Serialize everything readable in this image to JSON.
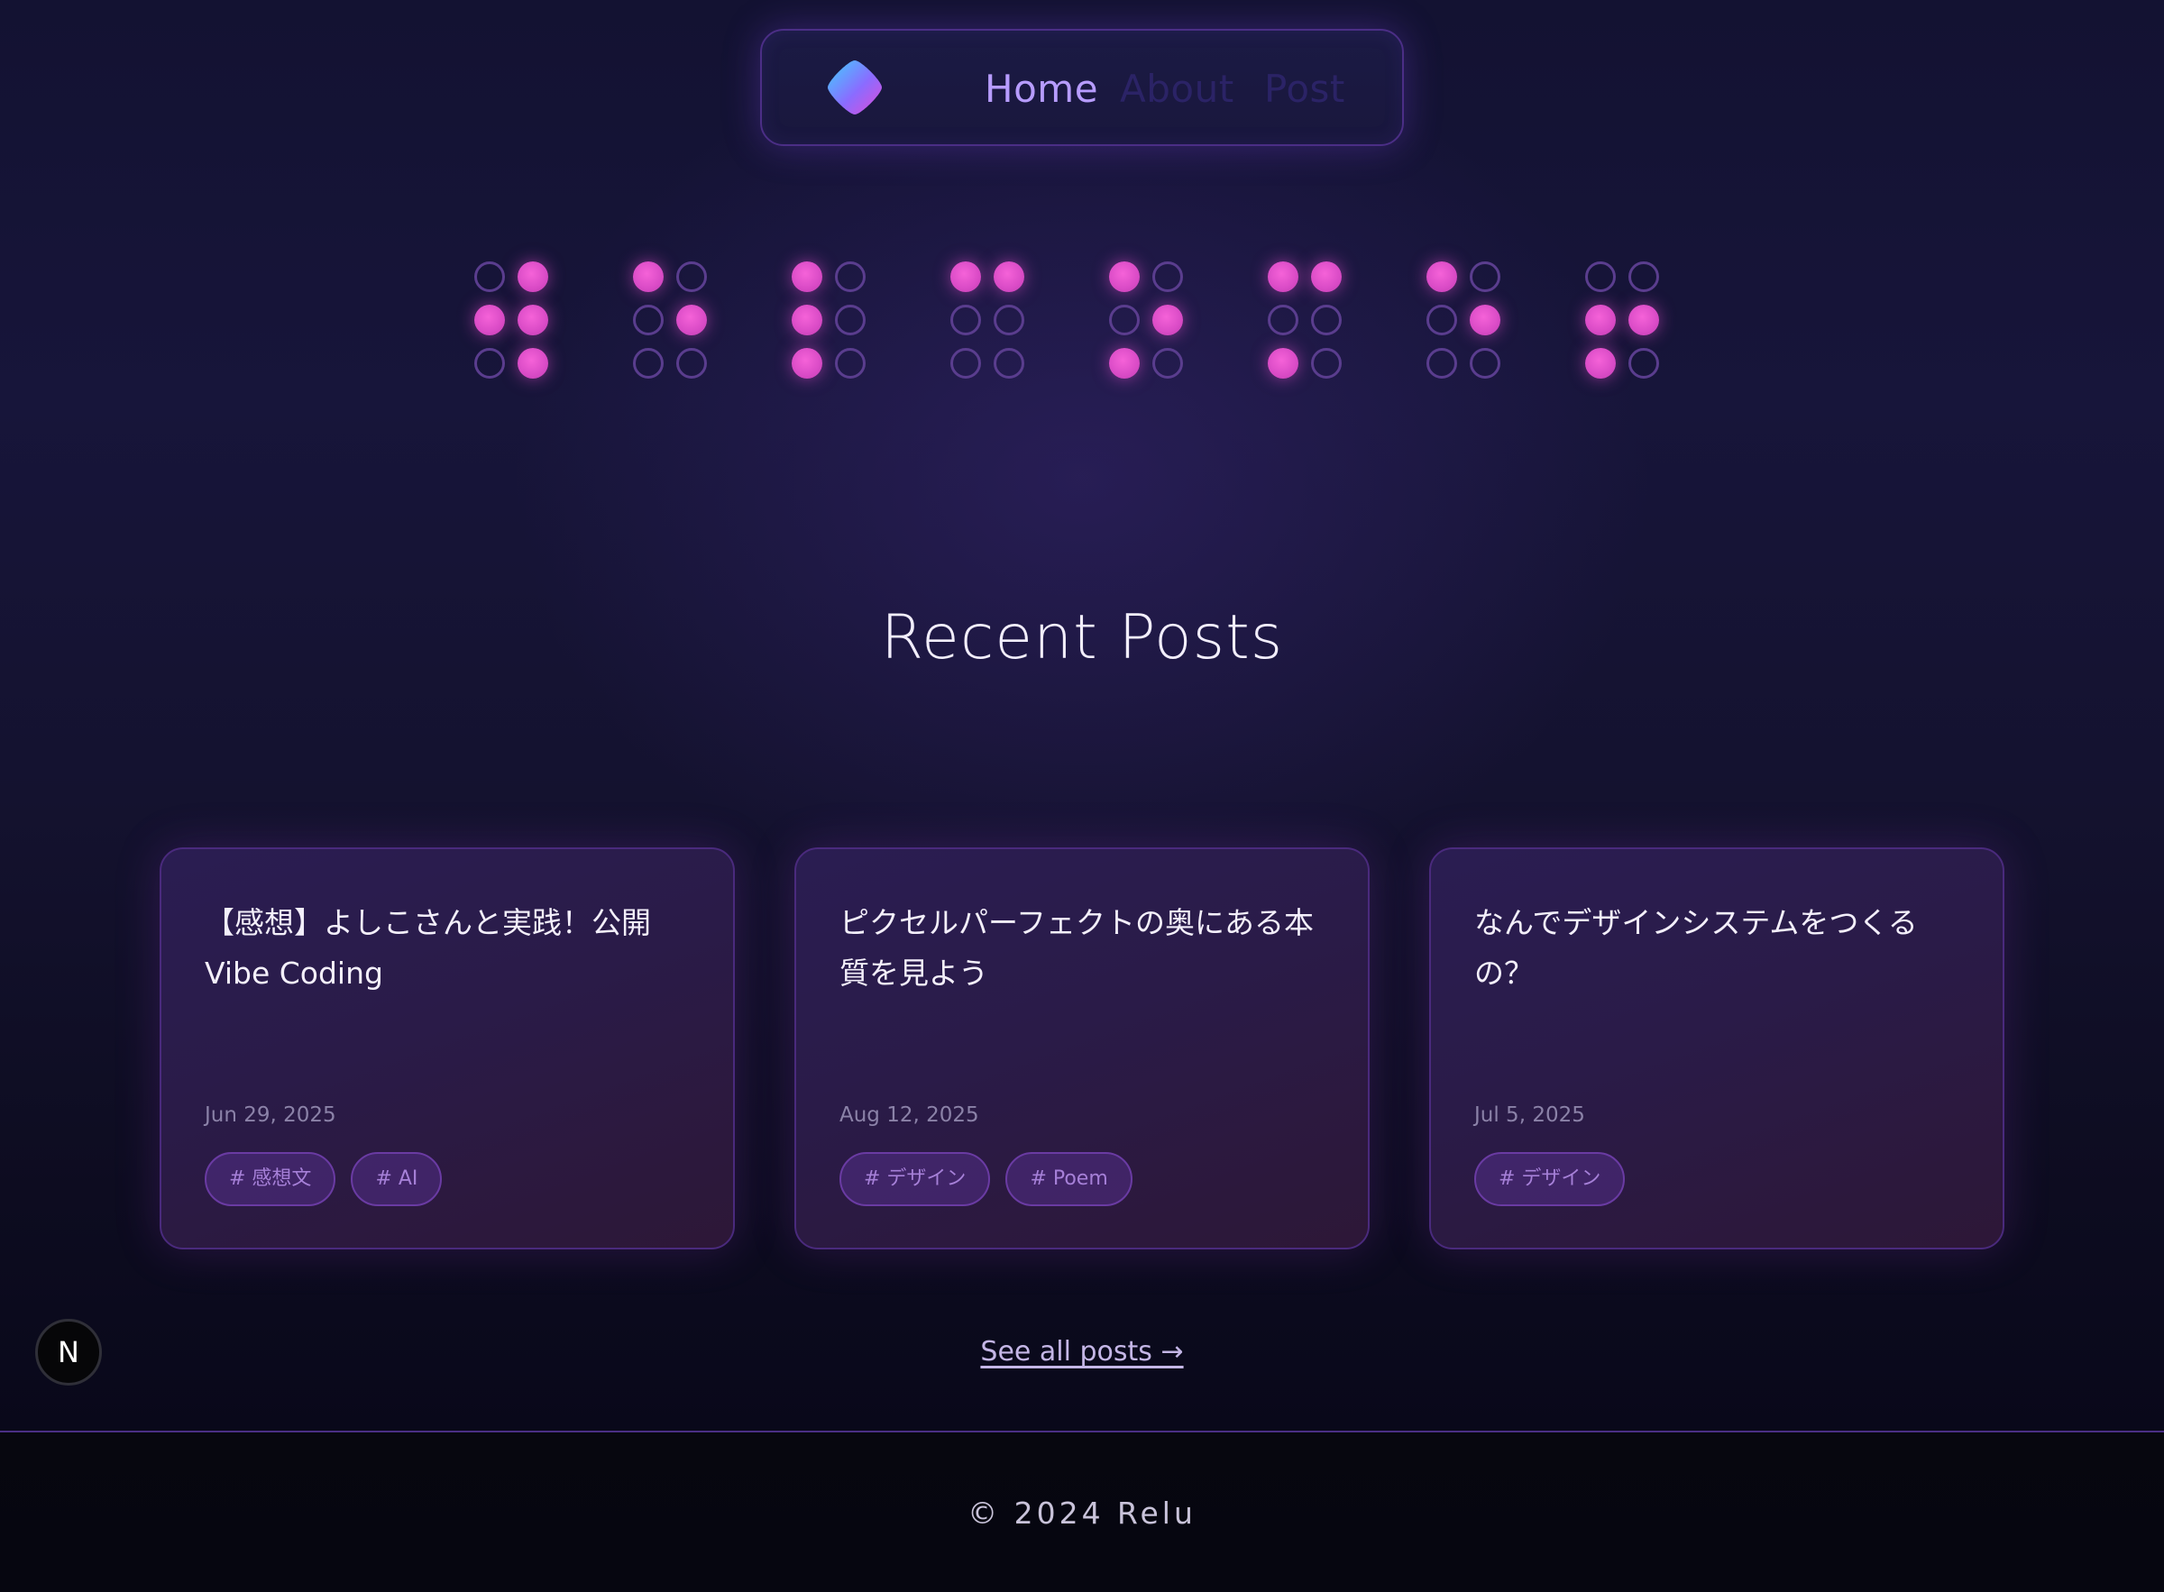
{
  "nav": {
    "logo": "logo-gem",
    "links": [
      {
        "label": "Home",
        "active": true
      },
      {
        "label": "About",
        "active": false
      },
      {
        "label": "Post",
        "active": false
      }
    ]
  },
  "dot_pattern": [
    [
      [
        0,
        1
      ],
      [
        1,
        1
      ],
      [
        0,
        1
      ]
    ],
    [
      [
        1,
        0
      ],
      [
        0,
        1
      ],
      [
        0,
        0
      ]
    ],
    [
      [
        1,
        0
      ],
      [
        1,
        0
      ],
      [
        1,
        0
      ]
    ],
    [
      [
        1,
        1
      ],
      [
        0,
        0
      ],
      [
        0,
        0
      ]
    ],
    [
      [
        1,
        0
      ],
      [
        0,
        1
      ],
      [
        1,
        0
      ]
    ],
    [
      [
        1,
        1
      ],
      [
        0,
        0
      ],
      [
        1,
        0
      ]
    ],
    [
      [
        1,
        0
      ],
      [
        0,
        1
      ],
      [
        0,
        0
      ]
    ],
    [
      [
        0,
        0
      ],
      [
        1,
        1
      ],
      [
        1,
        0
      ]
    ]
  ],
  "recent": {
    "title": "Recent Posts",
    "see_all": "See all posts →"
  },
  "posts": [
    {
      "title": "【感想】よしこさんと実践！公開Vibe Coding",
      "date": "Jun 29, 2025",
      "tags": [
        "# 感想文",
        "# AI"
      ]
    },
    {
      "title": "ピクセルパーフェクトの奥にある本質を見よう",
      "date": "Aug 12, 2025",
      "tags": [
        "# デザイン",
        "# Poem"
      ]
    },
    {
      "title": "なんでデザインシステムをつくるの？",
      "date": "Jul 5, 2025",
      "tags": [
        "# デザイン"
      ]
    }
  ],
  "badge": "N",
  "footer": {
    "copyright": "© 2024 Relu"
  },
  "colors": {
    "accent": "#b79cff",
    "dot_on": "#e455cf",
    "dot_off_border": "#5a3d8e",
    "tag_text": "#a680d8"
  }
}
